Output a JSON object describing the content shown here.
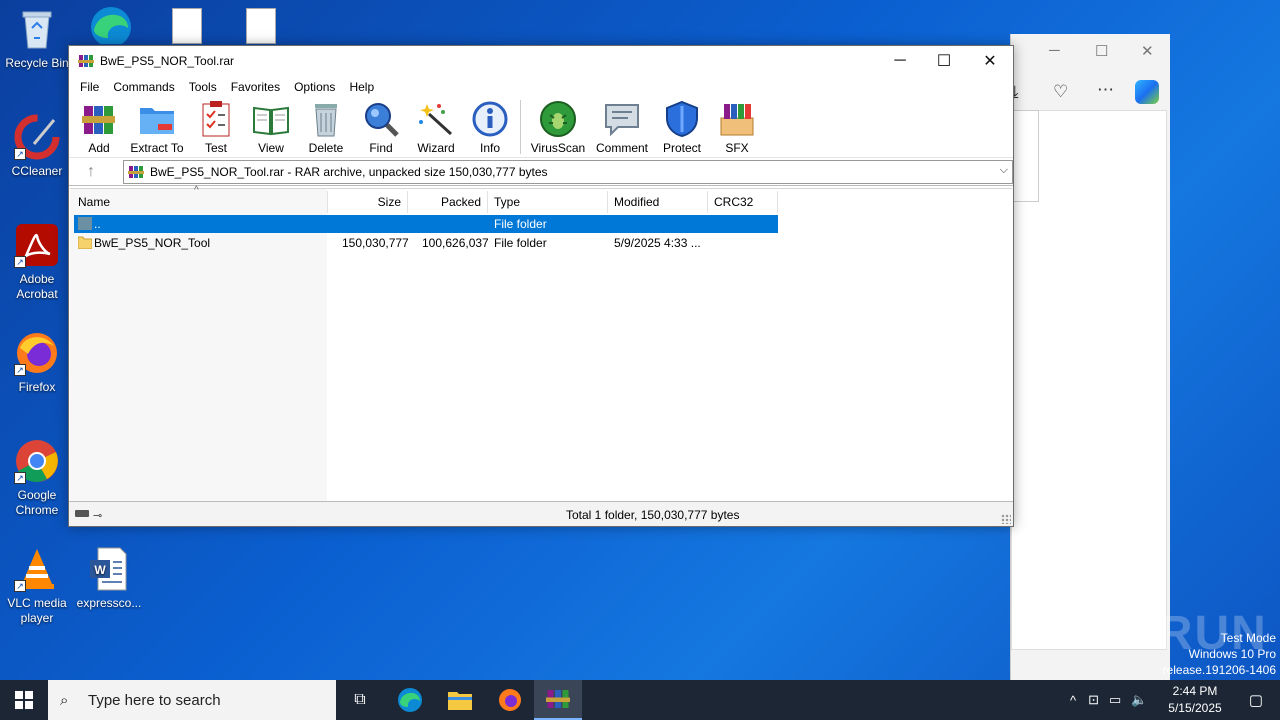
{
  "desktop": {
    "icons": [
      {
        "label": "Recycle Bin",
        "icon": "recycle-bin-icon"
      },
      {
        "label": "CCleaner",
        "icon": "ccleaner-icon"
      },
      {
        "label": "Adobe Acrobat",
        "icon": "adobe-acrobat-icon"
      },
      {
        "label": "Firefox",
        "icon": "firefox-icon"
      },
      {
        "label": "Google Chrome",
        "icon": "chrome-icon"
      },
      {
        "label": "VLC media player",
        "icon": "vlc-icon"
      },
      {
        "label": "expressco...",
        "icon": "word-document-icon"
      }
    ],
    "watermark": "ANY RUN",
    "test_mode": {
      "line1": "Test Mode",
      "line2": "Windows 10 Pro",
      "line3": "release.191206-1406"
    }
  },
  "window": {
    "title": "BwE_PS5_NOR_Tool.rar",
    "menu": [
      "File",
      "Commands",
      "Tools",
      "Favorites",
      "Options",
      "Help"
    ],
    "toolbar": [
      {
        "label": "Add",
        "icon": "add-archive-icon"
      },
      {
        "label": "Extract To",
        "icon": "extract-folder-icon"
      },
      {
        "label": "Test",
        "icon": "test-clipboard-icon"
      },
      {
        "label": "View",
        "icon": "view-book-icon"
      },
      {
        "label": "Delete",
        "icon": "delete-trash-icon"
      },
      {
        "label": "Find",
        "icon": "find-magnifier-icon"
      },
      {
        "label": "Wizard",
        "icon": "wizard-wand-icon"
      },
      {
        "label": "Info",
        "icon": "info-icon"
      },
      {
        "label": "VirusScan",
        "icon": "virusscan-bug-icon"
      },
      {
        "label": "Comment",
        "icon": "comment-icon"
      },
      {
        "label": "Protect",
        "icon": "protect-shield-icon"
      },
      {
        "label": "SFX",
        "icon": "sfx-box-icon"
      }
    ],
    "address": "BwE_PS5_NOR_Tool.rar - RAR archive, unpacked size 150,030,777 bytes",
    "columns": {
      "name": "Name",
      "size": "Size",
      "packed": "Packed",
      "type": "Type",
      "modified": "Modified",
      "crc": "CRC32"
    },
    "rows": [
      {
        "name": "..",
        "size": "",
        "packed": "",
        "type": "File folder",
        "modified": "",
        "crc": ""
      },
      {
        "name": "BwE_PS5_NOR_Tool",
        "size": "150,030,777",
        "packed": "100,626,037",
        "type": "File folder",
        "modified": "5/9/2025 4:33 ...",
        "crc": ""
      }
    ],
    "status": "Total 1 folder, 150,030,777 bytes"
  },
  "taskbar": {
    "search_placeholder": "Type here to search",
    "time": "2:44 PM",
    "date": "5/15/2025"
  }
}
